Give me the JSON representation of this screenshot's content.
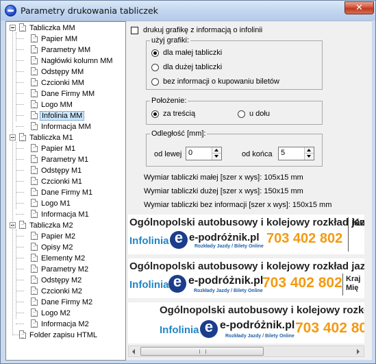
{
  "window": {
    "title": "Parametry drukowania tabliczek",
    "close_label": "✕"
  },
  "tree": {
    "nodes": [
      {
        "label": "Tabliczka MM",
        "level": 0,
        "expandable": true,
        "selected": false
      },
      {
        "label": "Papier MM",
        "level": 1,
        "selected": false
      },
      {
        "label": "Parametry MM",
        "level": 1,
        "selected": false
      },
      {
        "label": "Nagłówki kolumn MM",
        "level": 1,
        "selected": false
      },
      {
        "label": "Odstępy MM",
        "level": 1,
        "selected": false
      },
      {
        "label": "Czcionki MM",
        "level": 1,
        "selected": false
      },
      {
        "label": "Dane Firmy MM",
        "level": 1,
        "selected": false
      },
      {
        "label": "Logo MM",
        "level": 1,
        "selected": false
      },
      {
        "label": "Infolinia MM",
        "level": 1,
        "selected": true
      },
      {
        "label": "Informacja MM",
        "level": 1,
        "selected": false
      },
      {
        "label": "Tabliczka M1",
        "level": 0,
        "expandable": true,
        "selected": false
      },
      {
        "label": "Papier M1",
        "level": 1,
        "selected": false
      },
      {
        "label": "Parametry M1",
        "level": 1,
        "selected": false
      },
      {
        "label": "Odstępy M1",
        "level": 1,
        "selected": false
      },
      {
        "label": "Czcionki M1",
        "level": 1,
        "selected": false
      },
      {
        "label": "Dane Firmy M1",
        "level": 1,
        "selected": false
      },
      {
        "label": "Logo M1",
        "level": 1,
        "selected": false
      },
      {
        "label": "Informacja M1",
        "level": 1,
        "selected": false
      },
      {
        "label": "Tabliczka M2",
        "level": 0,
        "expandable": true,
        "selected": false
      },
      {
        "label": "Papier M2",
        "level": 1,
        "selected": false
      },
      {
        "label": "Opisy M2",
        "level": 1,
        "selected": false
      },
      {
        "label": "Elementy M2",
        "level": 1,
        "selected": false
      },
      {
        "label": "Parametry M2",
        "level": 1,
        "selected": false
      },
      {
        "label": "Odstępy M2",
        "level": 1,
        "selected": false
      },
      {
        "label": "Czcionki M2",
        "level": 1,
        "selected": false
      },
      {
        "label": "Dane Firmy M2",
        "level": 1,
        "selected": false
      },
      {
        "label": "Logo M2",
        "level": 1,
        "selected": false
      },
      {
        "label": "Informacja M2",
        "level": 1,
        "selected": false
      },
      {
        "label": "Folder zapisu HTML",
        "level": 0,
        "expandable": false,
        "selected": false
      }
    ]
  },
  "options": {
    "print_graphic_label": "drukuj grafikę z informacją o infolinii",
    "print_graphic_checked": false,
    "graphic_group": {
      "title": "użyj grafiki:",
      "options": [
        "dla małej tabliczki",
        "dla dużej tabliczki",
        "bez informacji o kupowaniu biletów"
      ],
      "selected": 0
    },
    "position_group": {
      "title": "Położenie:",
      "options": [
        "za treścią",
        "u dołu"
      ],
      "selected": 0
    },
    "distance_group": {
      "title": "Odległość [mm]:",
      "left_label": "od lewej",
      "left_value": "0",
      "end_label": "od końca",
      "end_value": "5"
    },
    "dims": [
      "Wymiar tabliczki małej [szer x wys]: 105x15 mm",
      "Wymiar tabliczki dużej [szer x wys]: 150x15 mm",
      "Wymiar tabliczki bez informacji [szer x wys]: 150x15 mm"
    ]
  },
  "previews": [
    {
      "title": "Ogólnopolski autobusowy i kolejowy rozkład jazdy",
      "infolinia": "Infolinia",
      "brand": "e-podróżnik.pl",
      "sub": "Rozkłady Jazdy / Bilety Online",
      "phone": "703 402 802",
      "side1": "Ku",
      "side2": ""
    },
    {
      "title": "Ogólnopolski autobusowy i kolejowy rozkład jazdy / Kup",
      "infolinia": "Infolinia",
      "brand": "e-podróżnik.pl",
      "sub": "Rozkłady Jazdy / Bilety Online",
      "phone": "703 402 802",
      "side1": "Kraj",
      "side2": "Mię"
    },
    {
      "title": "Ogólnopolski autobusowy i kolejowy rozkład jazdy",
      "infolinia": "Infolinia",
      "brand": "e-podróżnik.pl",
      "sub": "Rozkłady Jazdy / Bilety Online",
      "phone": "703 402 802",
      "side1": "",
      "side2": ""
    }
  ],
  "scroll": {
    "position": 0.0
  }
}
